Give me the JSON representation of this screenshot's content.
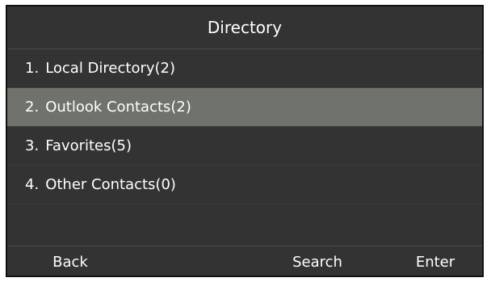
{
  "screen": {
    "title": "Directory",
    "items": [
      {
        "number": "1.",
        "label": "Local Directory(2)",
        "selected": false
      },
      {
        "number": "2.",
        "label": "Outlook Contacts(2)",
        "selected": true
      },
      {
        "number": "3.",
        "label": "Favorites(5)",
        "selected": false
      },
      {
        "number": "4.",
        "label": "Other Contacts(0)",
        "selected": false
      }
    ],
    "softkeys": {
      "back": "Back",
      "search": "Search",
      "enter": "Enter"
    }
  },
  "colors": {
    "background": "#333333",
    "selected_row": "#6f736c",
    "text": "#ffffff",
    "frame_border": "#111111"
  }
}
